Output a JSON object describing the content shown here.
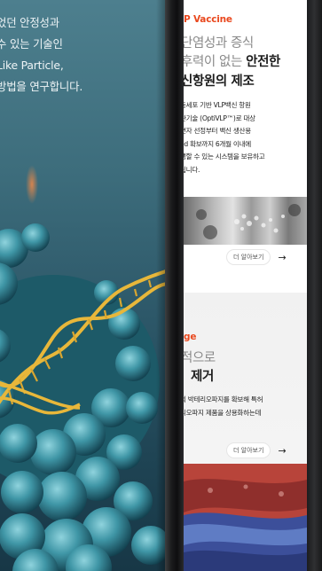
{
  "hero": {
    "text": "었던 안정성과\n수 있는 기술인\nLike Particle,\n방법을 연구합니다."
  },
  "phone": {
    "section1": {
      "tag": "P Vaccine",
      "line1": "단염성과 증식",
      "line2_light": "후력이 없는 ",
      "line2_bold": "안전한",
      "line3": "신항원의 제조",
      "description": "동세포 기반 VLP백신 항원\n관기술 (OptiVLP™)로 대상\n변자 선정부터 백신 생산용\ned 확보까지 6개월 이내에\n생할 수 있는 시스템을 보유하고\n됩니다.",
      "more_label": "더 알아보기",
      "more_arrow": "→"
    },
    "section2": {
      "tag": "ge",
      "line1": "적으로",
      "line2": "제거",
      "description": "의 박테리오파지를 확보해 특허\n리오파지 제품을 상용화하는데",
      "more_label": "더 알아보기",
      "more_arrow": "→"
    }
  },
  "colors": {
    "accent": "#e9481e",
    "hero_bg": "#2d5869",
    "screen_bg": "#ffffff"
  }
}
